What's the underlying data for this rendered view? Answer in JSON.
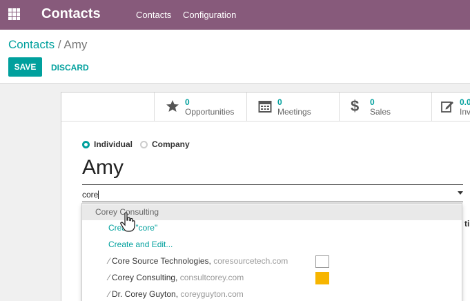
{
  "topbar": {
    "app_title": "Contacts",
    "menu": [
      "Contacts",
      "Configuration"
    ]
  },
  "breadcrumb": {
    "parent": "Contacts",
    "separator": "/",
    "current": "Amy"
  },
  "buttons": {
    "save": "SAVE",
    "discard": "DISCARD"
  },
  "stats": [
    {
      "icon": "star-icon",
      "count": "0",
      "label": "Opportunities"
    },
    {
      "icon": "calendar-icon",
      "count": "0",
      "label": "Meetings"
    },
    {
      "icon": "dollar-icon",
      "count": "0",
      "label": "Sales"
    },
    {
      "icon": "invoice-icon",
      "count": "0.0",
      "label": "Inv"
    }
  ],
  "type_options": {
    "individual": "Individual",
    "company": "Company",
    "selected": "Individual"
  },
  "name": "Amy",
  "company_field": {
    "value": "core"
  },
  "side_fragment": "ti",
  "dropdown": {
    "items": [
      {
        "text": "Corey Consulting",
        "kind": "suggestion",
        "highlighted": true
      },
      {
        "text": "Create \"core\"",
        "kind": "create"
      },
      {
        "text": "Create and Edit...",
        "kind": "create-edit"
      },
      {
        "name": "Core Source Technologies,",
        "domain": "coresourcetech.com",
        "logo": "broken"
      },
      {
        "name": "Corey Consulting,",
        "domain": "consultcorey.com",
        "logo": "yellow"
      },
      {
        "name": "Dr. Corey Guyton,",
        "domain": "coreyguyton.com",
        "logo": ""
      }
    ]
  },
  "colors": {
    "brand": "#875a7b",
    "accent": "#00a09d"
  }
}
